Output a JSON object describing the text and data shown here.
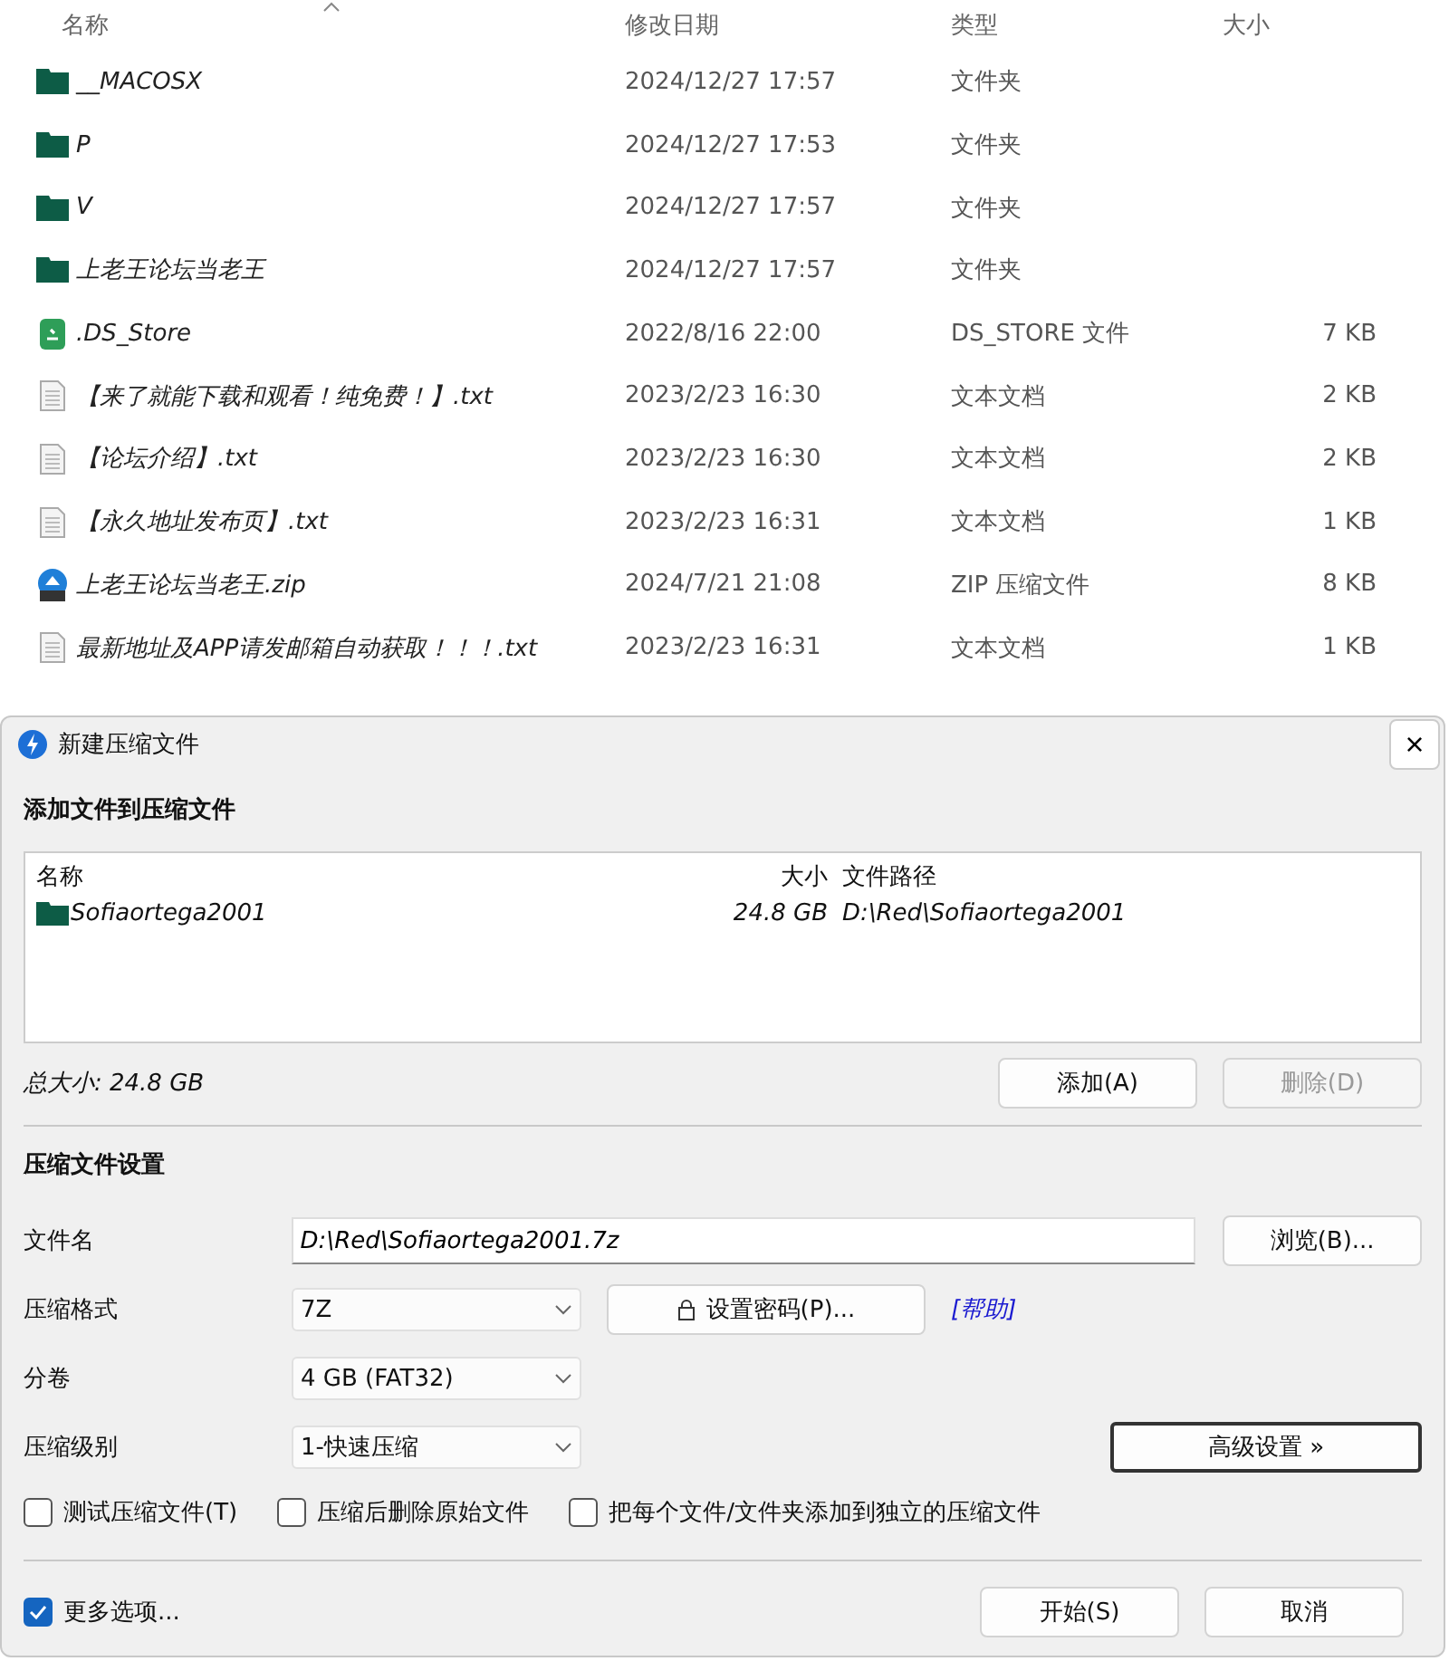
{
  "explorer": {
    "columns": [
      "名称",
      "修改日期",
      "类型",
      "大小"
    ],
    "files": [
      {
        "kind": "folder",
        "name": "__MACOSX",
        "date": "2024/12/27 17:57",
        "type": "文件夹"
      },
      {
        "kind": "folder",
        "name": "P",
        "date": "2024/12/27 17:53",
        "type": "文件夹"
      },
      {
        "kind": "folder",
        "name": "V",
        "date": "2024/12/27 17:57",
        "type": "文件夹"
      },
      {
        "kind": "folder",
        "name": "上老王论坛当老王",
        "date": "2024/12/27 17:57",
        "type": "文件夹"
      },
      {
        "kind": "ds_store",
        "name": ".DS_Store",
        "date": "2022/8/16 22:00",
        "type": "DS_STORE 文件",
        "size": "7 KB"
      },
      {
        "kind": "txt",
        "name": "【来了就能下载和观看！纯免费！】.txt",
        "date": "2023/2/23 16:30",
        "type": "文本文档",
        "size": "2 KB"
      },
      {
        "kind": "txt",
        "name": "【论坛介绍】.txt",
        "date": "2023/2/23 16:30",
        "type": "文本文档",
        "size": "2 KB"
      },
      {
        "kind": "txt",
        "name": "【永久地址发布页】.txt",
        "date": "2023/2/23 16:31",
        "type": "文本文档",
        "size": "1 KB"
      },
      {
        "kind": "zip",
        "name": "上老王论坛当老王.zip",
        "date": "2024/7/21 21:08",
        "type": "ZIP 压缩文件",
        "size": "8 KB"
      },
      {
        "kind": "txt",
        "name": "最新地址及APP请发邮箱自动获取！！！.txt",
        "date": "2023/2/23 16:31",
        "type": "文本文档",
        "size": "1 KB"
      }
    ]
  },
  "dialog": {
    "title": "新建压缩文件",
    "close": "×",
    "add_section": {
      "title": "添加文件到压缩文件",
      "columns": [
        "名称",
        "大小",
        "文件路径"
      ],
      "items": [
        {
          "name": "Sofiaortega2001",
          "size": "24.8 GB",
          "path": "D:\\Red\\Sofiaortega2001"
        }
      ],
      "total": "总大小: 24.8 GB",
      "buttons": [
        {
          "label": "添加(A)",
          "disabled": false
        },
        {
          "label": "删除(D)",
          "disabled": true
        }
      ]
    },
    "settings": {
      "title": "压缩文件设置",
      "filename": {
        "label": "文件名",
        "value": "D:\\Red\\Sofiaortega2001.7z",
        "browse": "浏览(B)..."
      },
      "format": {
        "label": "压缩格式",
        "value": "7Z"
      },
      "password_button": "设置密码(P)...",
      "help_link": "[帮助]",
      "split": {
        "label": "分卷",
        "value": "4 GB (FAT32)"
      },
      "level": {
        "label": "压缩级别",
        "value": "1-快速压缩"
      },
      "advanced_button": "高级设置 »",
      "options": [
        {
          "label": "测试压缩文件(T)",
          "checked": false
        },
        {
          "label": "压缩后删除原始文件",
          "checked": false
        },
        {
          "label": "把每个文件/文件夹添加到独立的压缩文件",
          "checked": false
        }
      ]
    },
    "more_options": {
      "label": "更多选项...",
      "checked": true
    },
    "buttons": [
      {
        "label": "开始(S)"
      },
      {
        "label": "取消"
      }
    ]
  }
}
